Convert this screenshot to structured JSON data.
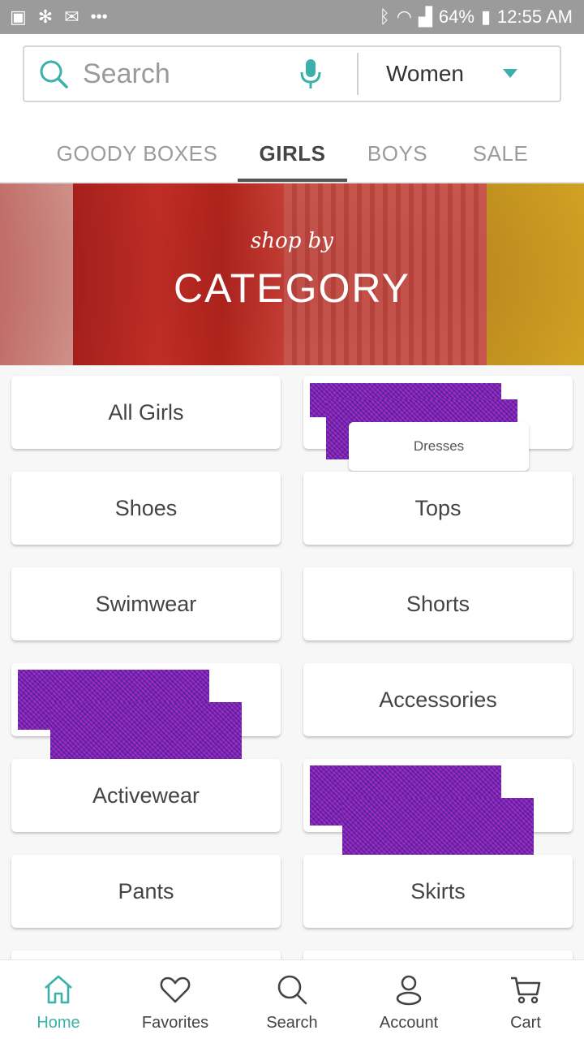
{
  "status_bar": {
    "left_icons": [
      "image-icon",
      "network-icon",
      "mail-icon",
      "more-icon"
    ],
    "more": "•••",
    "battery": "64%",
    "time": "12:55 AM"
  },
  "search": {
    "placeholder": "Search",
    "department": "Women"
  },
  "tabs": [
    {
      "label": "GOODY BOXES",
      "active": false
    },
    {
      "label": "GIRLS",
      "active": true
    },
    {
      "label": "BOYS",
      "active": false
    },
    {
      "label": "SALE",
      "active": false
    }
  ],
  "hero": {
    "subtitle": "shop by",
    "title": "CATEGORY"
  },
  "categories": {
    "all_girls": "All Girls",
    "dresses": "Dresses",
    "shoes": "Shoes",
    "tops": "Tops",
    "swimwear": "Swimwear",
    "shorts": "Shorts",
    "accessories": "Accessories",
    "activewear": "Activewear",
    "pants": "Pants",
    "skirts": "Skirts"
  },
  "bottom_nav": [
    {
      "label": "Home",
      "icon": "home-icon",
      "active": true
    },
    {
      "label": "Favorites",
      "icon": "heart-icon",
      "active": false
    },
    {
      "label": "Search",
      "icon": "search-icon",
      "active": false
    },
    {
      "label": "Account",
      "icon": "account-icon",
      "active": false
    },
    {
      "label": "Cart",
      "icon": "cart-icon",
      "active": false
    }
  ],
  "colors": {
    "accent": "#3cb0aa",
    "status_bar": "#9b9b9b"
  }
}
